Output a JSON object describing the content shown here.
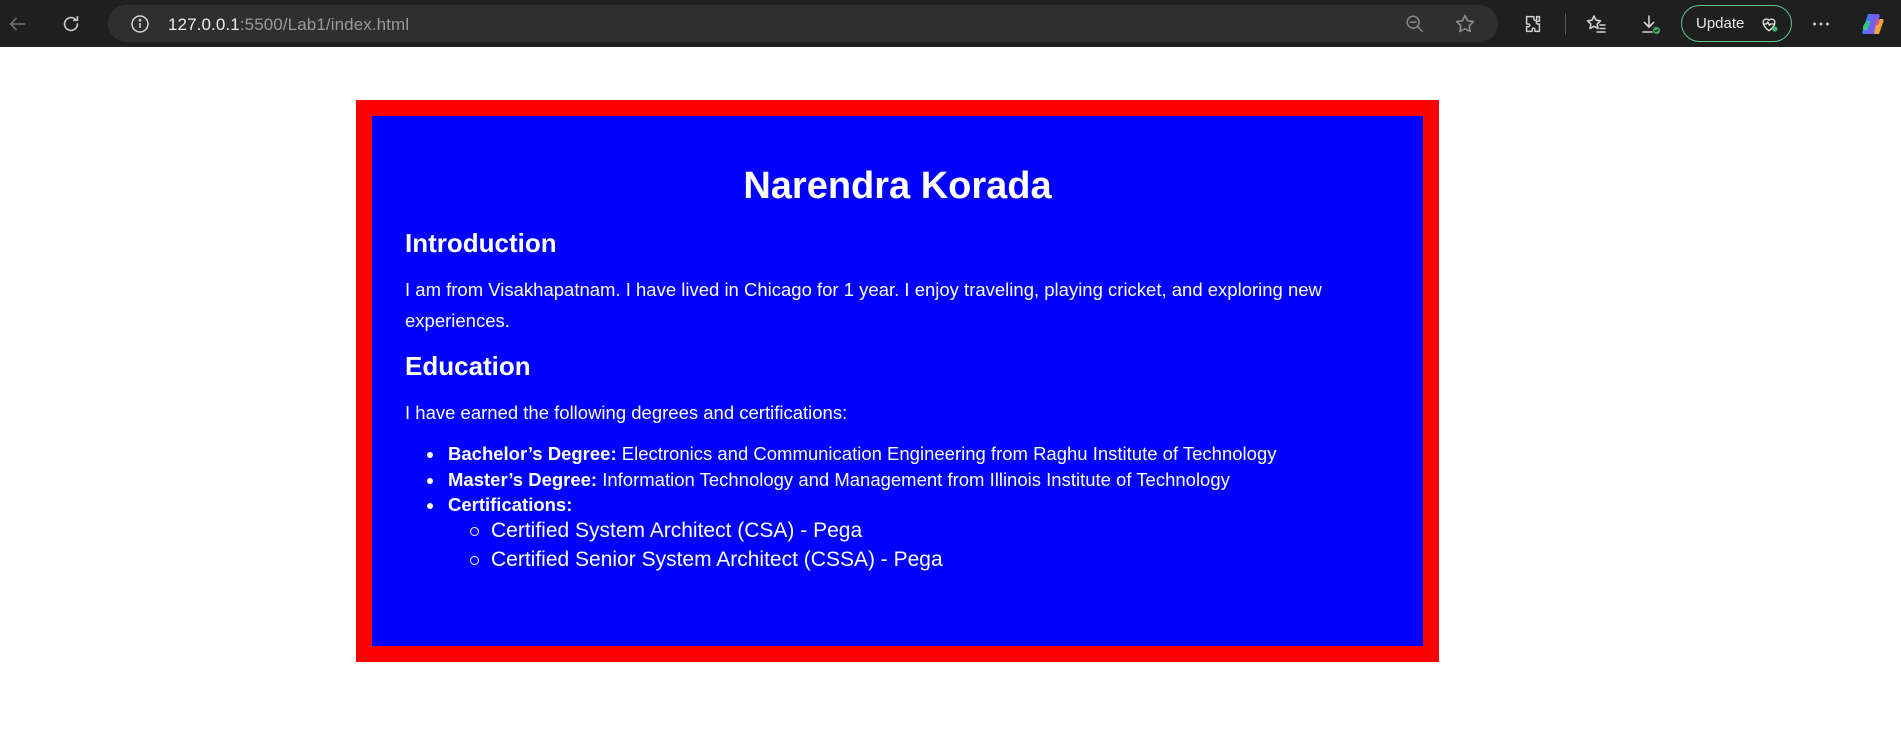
{
  "browser": {
    "url_host": "127.0.0.1",
    "url_rest": ":5500/Lab1/index.html",
    "update_label": "Update",
    "icons": [
      "back-icon",
      "reload-icon",
      "site-info-icon",
      "zoom-out-icon",
      "add-favorite-icon",
      "extensions-icon",
      "favorites-icon",
      "downloads-icon",
      "health-heart-icon",
      "more-icon",
      "copilot-icon"
    ]
  },
  "page": {
    "name": "Narendra Korada",
    "intro_heading": "Introduction",
    "intro_text": "I am from Visakhapatnam. I have lived in Chicago for 1 year. I enjoy traveling, playing cricket, and exploring new experiences.",
    "education_heading": "Education",
    "education_text": "I have earned the following degrees and certifications:",
    "degrees": [
      {
        "label": "Bachelor’s Degree:",
        "text": "Electronics and Communication Engineering from Raghu Institute of Technology"
      },
      {
        "label": "Master’s Degree:",
        "text": "Information Technology and Management from Illinois Institute of Technology"
      },
      {
        "label": "Certifications:",
        "text": ""
      }
    ],
    "certifications": [
      "Certified System Architect (CSA) - Pega",
      "Certified Senior System Architect (CSSA) - Pega"
    ],
    "colors": {
      "card_background": "#0000ff",
      "card_border": "#ff0000",
      "text": "#ffffff"
    }
  }
}
